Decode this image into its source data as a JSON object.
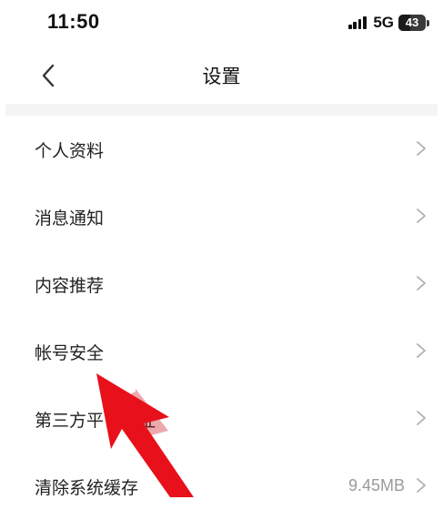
{
  "status_bar": {
    "time": "11:50",
    "network": "5G",
    "battery": "43",
    "battery_fraction": 0.43,
    "icons": [
      "signal-icon",
      "battery-icon"
    ]
  },
  "nav": {
    "title": "设置",
    "back_icon": "back-chevron-icon"
  },
  "settings": {
    "items": [
      {
        "label": "个人资料",
        "value": ""
      },
      {
        "label": "消息通知",
        "value": ""
      },
      {
        "label": "内容推荐",
        "value": ""
      },
      {
        "label": "帐号安全",
        "value": ""
      },
      {
        "label": "第三方平台认证",
        "value": ""
      },
      {
        "label": "清除系统缓存",
        "value": "9.45MB"
      }
    ]
  },
  "annotation": {
    "icon": "red-pointer-arrow-icon",
    "color": "#e8101a"
  },
  "colors": {
    "text": "#222222",
    "secondary_text": "#9a9a9a",
    "divider": "#f4f4f4",
    "chevron": "#b0b0b0"
  }
}
